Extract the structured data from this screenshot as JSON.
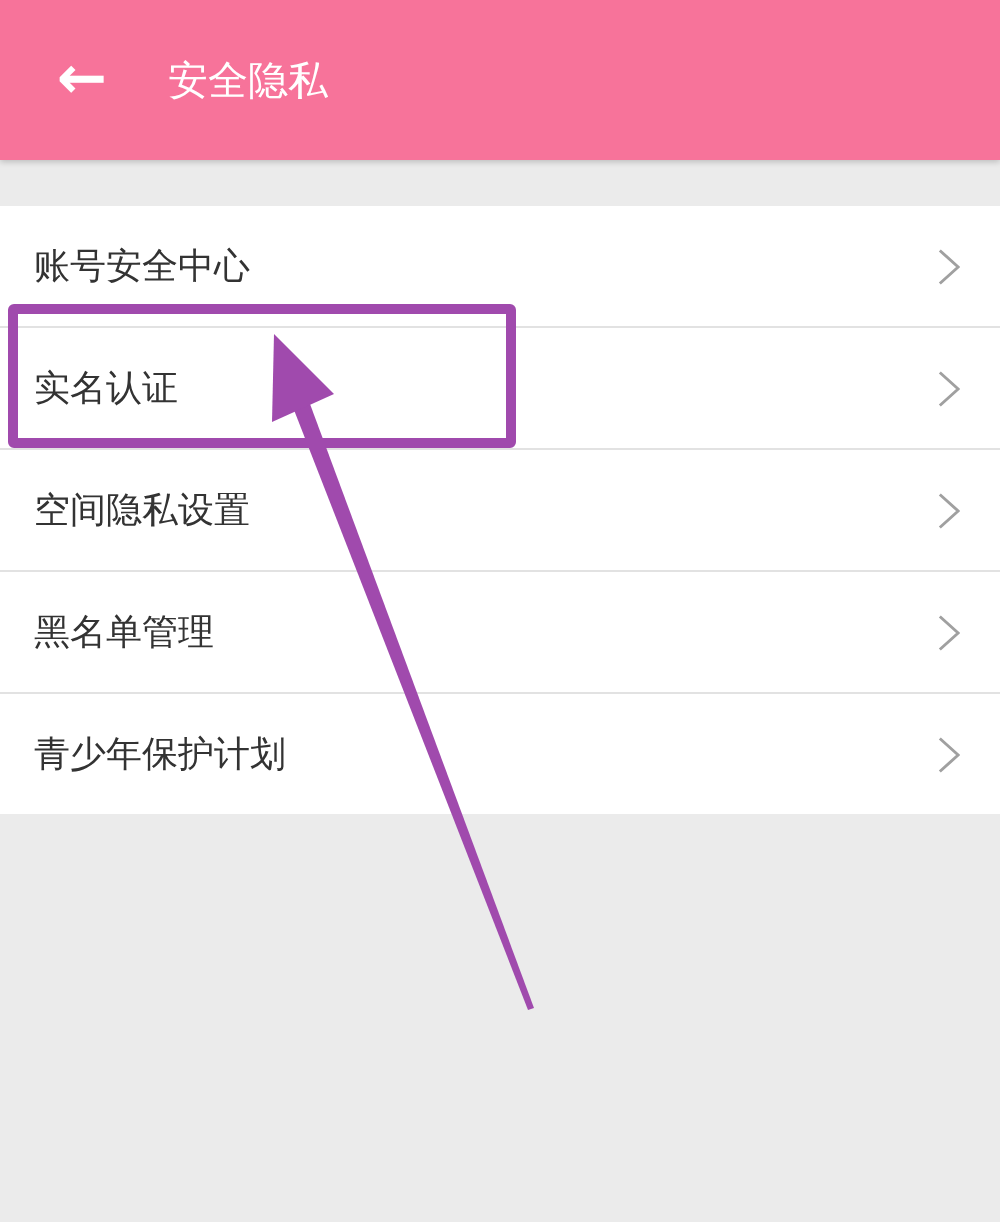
{
  "header": {
    "back_icon": "←",
    "title": "安全隐私"
  },
  "items": [
    {
      "label": "账号安全中心",
      "highlighted": false
    },
    {
      "label": "实名认证",
      "highlighted": true
    },
    {
      "label": "空间隐私设置",
      "highlighted": false
    },
    {
      "label": "黑名单管理",
      "highlighted": false
    },
    {
      "label": "青少年保护计划",
      "highlighted": false
    }
  ]
}
